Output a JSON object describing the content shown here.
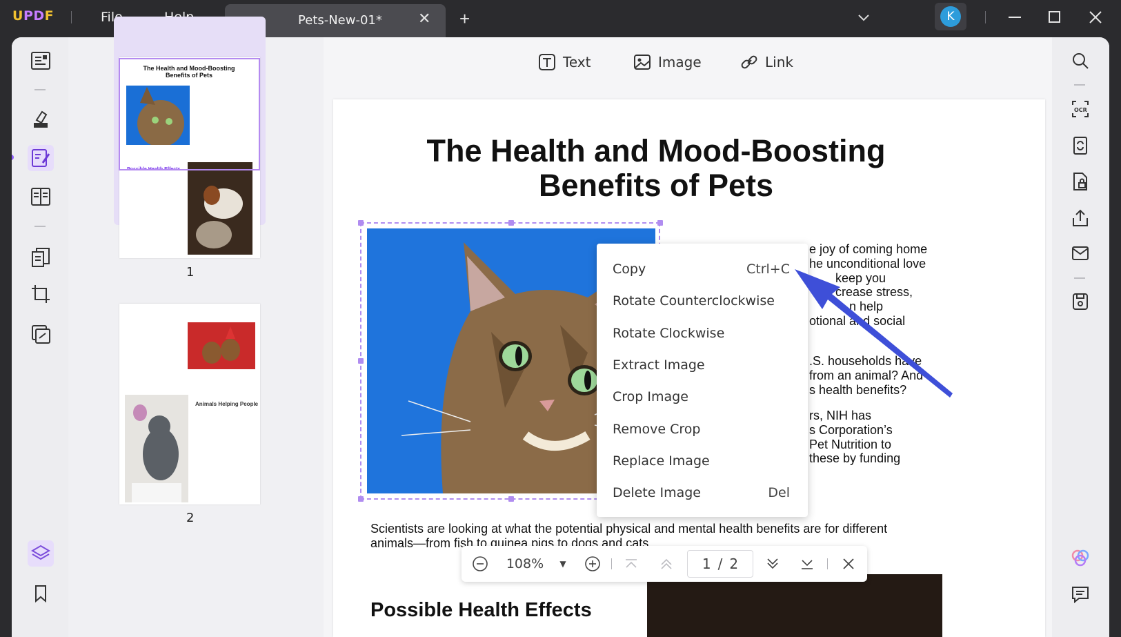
{
  "app": {
    "logo": "UPDF"
  },
  "menu": {
    "file": "File",
    "help": "Help"
  },
  "tab": {
    "title": "Pets-New-01*"
  },
  "user": {
    "avatar_initial": "K"
  },
  "toolbar": {
    "text": "Text",
    "image": "Image",
    "link": "Link"
  },
  "thumbnails": {
    "page1": {
      "heading": "The Health and Mood-Boosting Benefits of Pets",
      "subheading": "Possible Health Effects",
      "number": "1"
    },
    "page2": {
      "subheading": "Animals Helping People",
      "number": "2"
    }
  },
  "document": {
    "title_line1": "The Health and Mood-Boosting",
    "title_line2": "Benefits of Pets",
    "para1": [
      "e joy of coming home",
      "he unconditional love",
      "keep you",
      "crease stress,",
      "n help",
      "otional and social"
    ],
    "para2": [
      ".S. households have",
      "from an animal? And",
      "s health benefits?"
    ],
    "para3": [
      "rs,  NIH  has",
      "s Corporation’s",
      "Pet  Nutrition  to",
      "these by funding"
    ],
    "para4": [
      "Scientists are looking at what the potential physical and mental health benefits are for different",
      "animals—from fish to guinea pigs to dogs and cats."
    ],
    "section_heading": "Possible Health Effects"
  },
  "context_menu": {
    "items": [
      {
        "label": "Copy",
        "shortcut": "Ctrl+C"
      },
      {
        "label": "Rotate Counterclockwise",
        "shortcut": ""
      },
      {
        "label": "Rotate Clockwise",
        "shortcut": ""
      },
      {
        "label": "Extract Image",
        "shortcut": ""
      },
      {
        "label": "Crop Image",
        "shortcut": ""
      },
      {
        "label": "Remove Crop",
        "shortcut": ""
      },
      {
        "label": "Replace Image",
        "shortcut": ""
      },
      {
        "label": "Delete Image",
        "shortcut": "Del"
      }
    ]
  },
  "zoom": {
    "level": "108%",
    "page_current": "1",
    "page_sep": "/",
    "page_total": "2"
  },
  "colors": {
    "accent": "#b08cf0",
    "arrow": "#3e4fd8",
    "logo_yellow": "#f2c230",
    "logo_purple": "#c77dff",
    "avatar": "#2d9cdb"
  }
}
